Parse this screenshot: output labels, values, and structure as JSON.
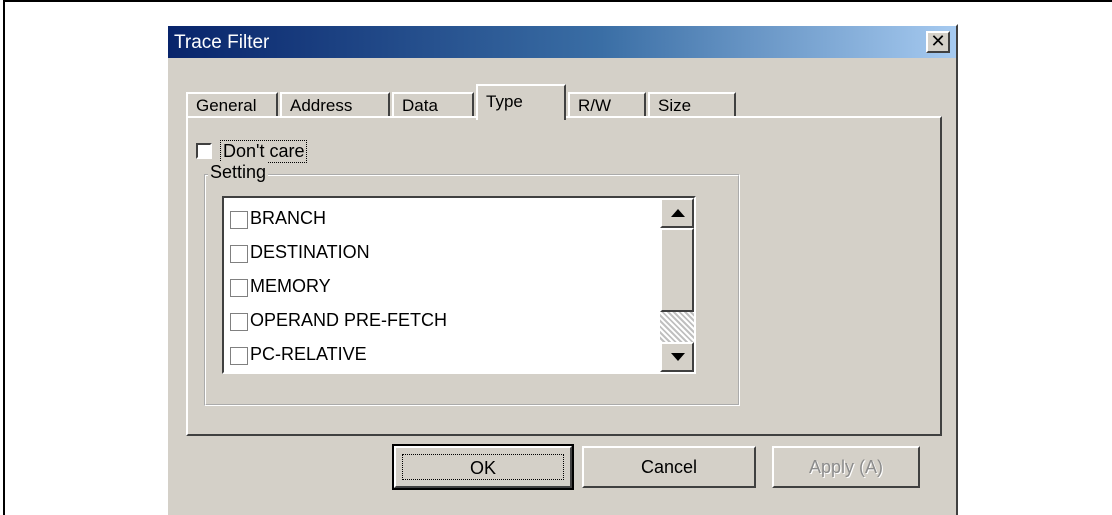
{
  "dialog": {
    "title": "Trace Filter",
    "close_glyph": "✕"
  },
  "tabs": [
    {
      "label": "General",
      "active": false
    },
    {
      "label": "Address",
      "active": false
    },
    {
      "label": "Data",
      "active": false
    },
    {
      "label": "Type",
      "active": true
    },
    {
      "label": "R/W",
      "active": false
    },
    {
      "label": "Size",
      "active": false
    }
  ],
  "dont_care": {
    "label": "Don't care",
    "checked": false
  },
  "setting": {
    "group_label": "Setting",
    "items": [
      {
        "label": "BRANCH",
        "checked": false
      },
      {
        "label": "DESTINATION",
        "checked": false
      },
      {
        "label": "MEMORY",
        "checked": false
      },
      {
        "label": "OPERAND PRE-FETCH",
        "checked": false
      },
      {
        "label": "PC-RELATIVE",
        "checked": false
      }
    ]
  },
  "buttons": {
    "ok": "OK",
    "cancel": "Cancel",
    "apply": "Apply (A)"
  },
  "colors": {
    "face": "#d4d0c8",
    "title_start": "#08246b",
    "title_end": "#a6caf0"
  }
}
